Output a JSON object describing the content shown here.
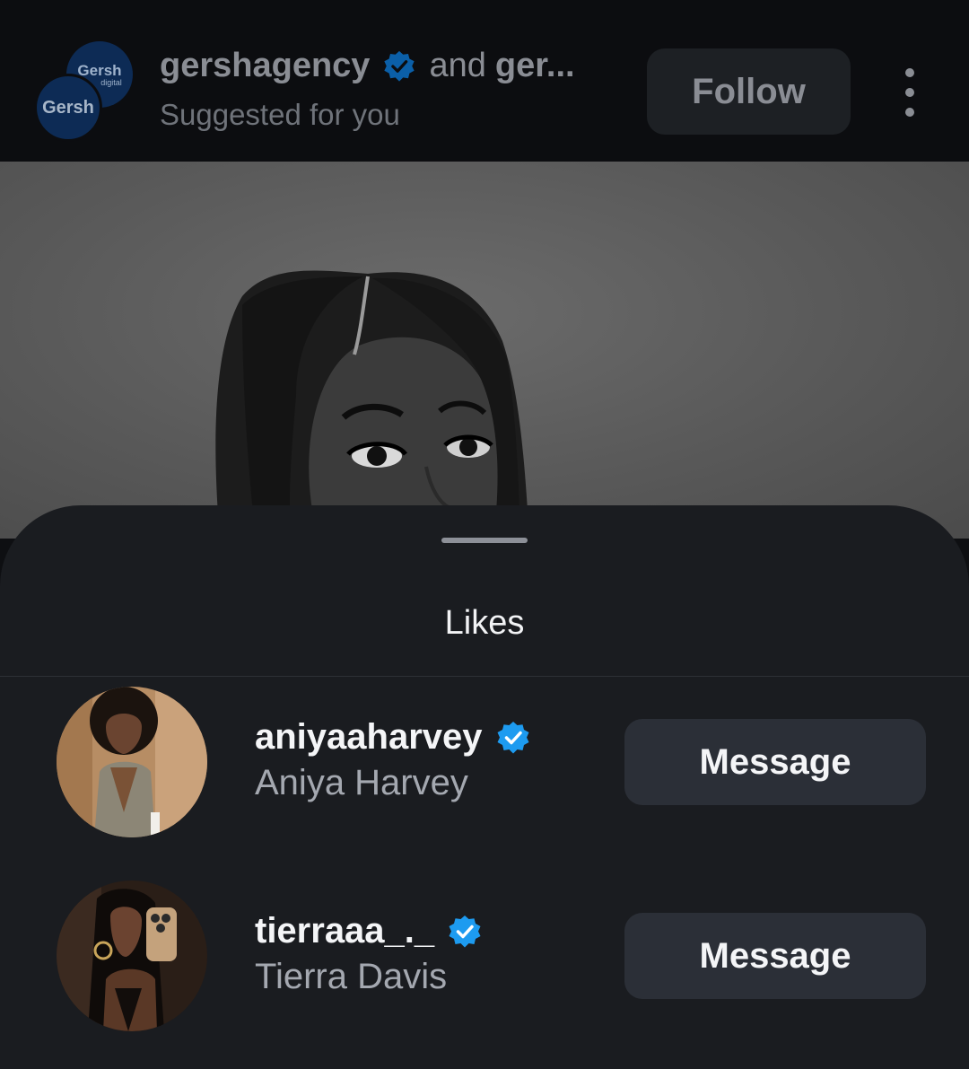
{
  "post_header": {
    "avatar_back_text": "Gersh",
    "avatar_back_sub": "digital",
    "avatar_front_text": "Gersh",
    "username": "gershagency",
    "and_text": "and",
    "more_text": "ger...",
    "subtitle": "Suggested for you",
    "follow_label": "Follow"
  },
  "sheet": {
    "title": "Likes",
    "users": [
      {
        "username": "aniyaaharvey",
        "name": "Aniya Harvey",
        "verified": true,
        "button": "Message"
      },
      {
        "username": "tierraaa_._",
        "name": "Tierra Davis",
        "verified": true,
        "button": "Message"
      }
    ]
  },
  "colors": {
    "verified_badge": "#1d9bf0",
    "sheet_bg": "#1a1c20",
    "button_bg": "#2b2f37"
  }
}
